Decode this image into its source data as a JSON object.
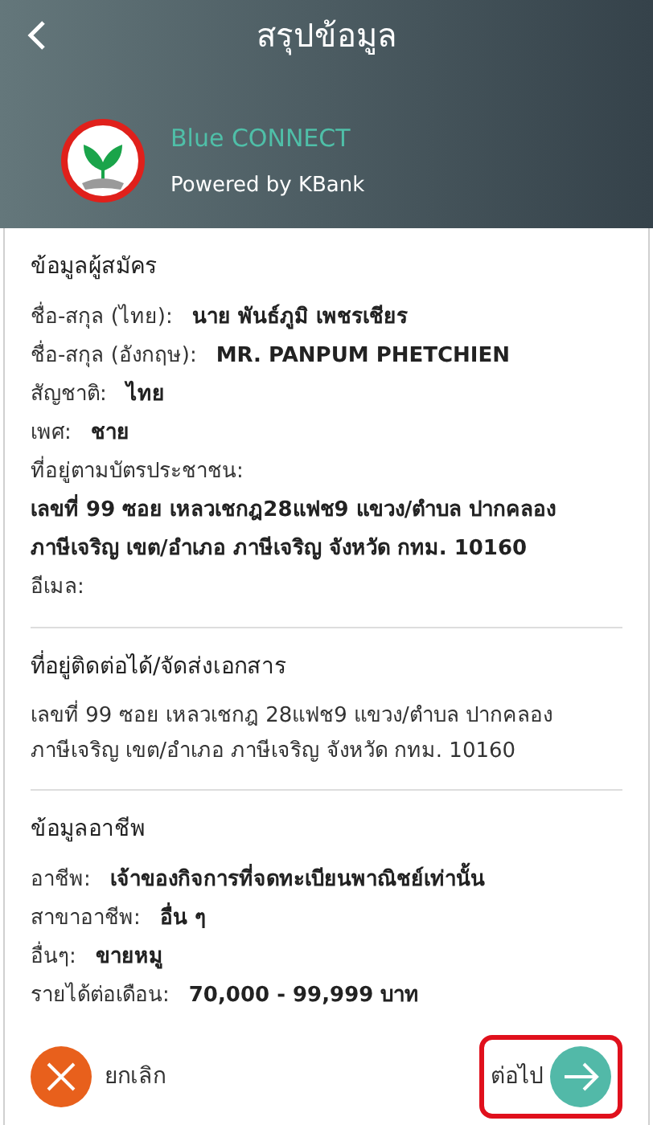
{
  "header": {
    "title": "สรุปข้อมูล",
    "brand_name": "Blue CONNECT",
    "brand_tagline": "Powered by KBank"
  },
  "sections": [
    {
      "title": "ข้อมูลผู้สมัคร",
      "items": [
        {
          "kind": "pair",
          "label": "ชื่อ-สกุล (ไทย):",
          "value": "นาย พันธ์ภูมิ เพชรเชียร"
        },
        {
          "kind": "pair",
          "label": "ชื่อ-สกุล (อังกฤษ):",
          "value": "MR. PANPUM PHETCHIEN"
        },
        {
          "kind": "pair",
          "label": "สัญชาติ:",
          "value": "ไทย"
        },
        {
          "kind": "pair",
          "label": "เพศ:",
          "value": "ชาย"
        },
        {
          "kind": "stacked",
          "label": "ที่อยู่ตามบัตรประชาชน:",
          "value": "เลขที่ 99 ซอย เหลวเชกฎ28แฟช9 แขวง/ตำบล ปากคลอง ภาษีเจริญ เขต/อำเภอ ภาษีเจริญ จังหวัด กทม. 10160"
        },
        {
          "kind": "pair",
          "label": "อีเมล:"
        }
      ]
    },
    {
      "title": "ที่อยู่ติดต่อได้/จัดส่งเอกสาร",
      "items": [
        {
          "kind": "paragraph",
          "value": "เลขที่ 99 ซอย เหลวเชกฎ 28แฟช9 แขวง/ตำบล ปากคลอง ภาษีเจริญ เขต/อำเภอ ภาษีเจริญ จังหวัด กทม. 10160"
        }
      ]
    },
    {
      "title": "ข้อมูลอาชีพ",
      "items": [
        {
          "kind": "pair",
          "label": "อาชีพ:",
          "value": "เจ้าของกิจการที่จดทะเบียนพาณิชย์เท่านั้น"
        },
        {
          "kind": "pair",
          "label": "สาขาอาชีพ:",
          "value": "อื่น ๆ"
        },
        {
          "kind": "pair",
          "label": "อื่นๆ:",
          "value": "ขายหมู"
        },
        {
          "kind": "pair",
          "label": "รายได้ต่อเดือน:",
          "value": "70,000 - 99,999 บาท"
        }
      ]
    }
  ],
  "footer": {
    "cancel_label": "ยกเลิก",
    "next_label": "ต่อไป",
    "next_highlighted": true
  }
}
